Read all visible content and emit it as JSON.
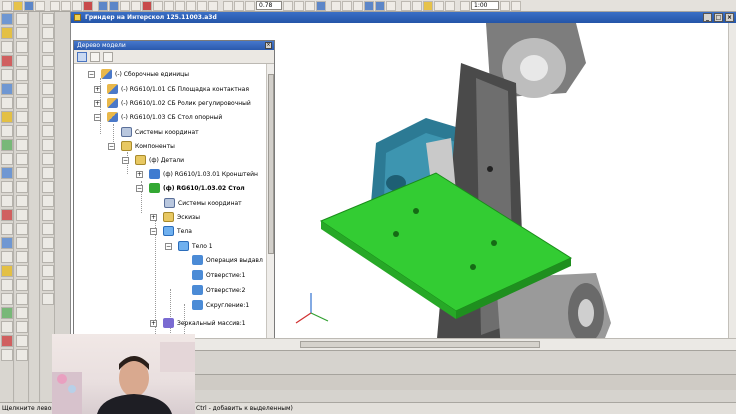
{
  "toolbar": {
    "zoom_value": "0.78",
    "right_field_value": "1:00"
  },
  "document": {
    "title": "Гриндер на Интерскол 125.11003.a3d"
  },
  "tree_panel": {
    "title": "Дерево модели",
    "items": [
      {
        "label": "(-) Сборочные единицы",
        "bold": false
      },
      {
        "label": "(-) RG610/1.01 СБ Площадка контактная",
        "bold": false
      },
      {
        "label": "(-) RG610/1.02 СБ Ролик регулировочный",
        "bold": false
      },
      {
        "label": "(-) RG610/1.03 СБ Стол опорный",
        "bold": false
      },
      {
        "label": "Системы координат",
        "bold": false
      },
      {
        "label": "Компоненты",
        "bold": false
      },
      {
        "label": "(ф) Детали",
        "bold": false
      },
      {
        "label": "(ф) RG610/1.03.01 Кронштейн",
        "bold": false
      },
      {
        "label": "(ф) RG610/1.03.02 Стол",
        "bold": true
      },
      {
        "label": "Системы координат",
        "bold": false
      },
      {
        "label": "Эскизы",
        "bold": false
      },
      {
        "label": "Тела",
        "bold": false
      },
      {
        "label": "Тело 1",
        "bold": false
      },
      {
        "label": "Операция выдавл",
        "bold": false
      },
      {
        "label": "Отверстие:1",
        "bold": false
      },
      {
        "label": "Отверстие:2",
        "bold": false
      },
      {
        "label": "Скругление:1",
        "bold": false
      },
      {
        "label": "Зеркальный массив:1",
        "bold": false
      }
    ]
  },
  "statusbar": {
    "left_text": "Щелкните левой кн",
    "right_text": "Ctrl - добавить к выделенным)"
  },
  "colors": {
    "selected_part": "#33cc33",
    "title_bar": "#2a59ad",
    "dark_part": "#4a4a4a",
    "teal_part": "#2c7a94"
  }
}
